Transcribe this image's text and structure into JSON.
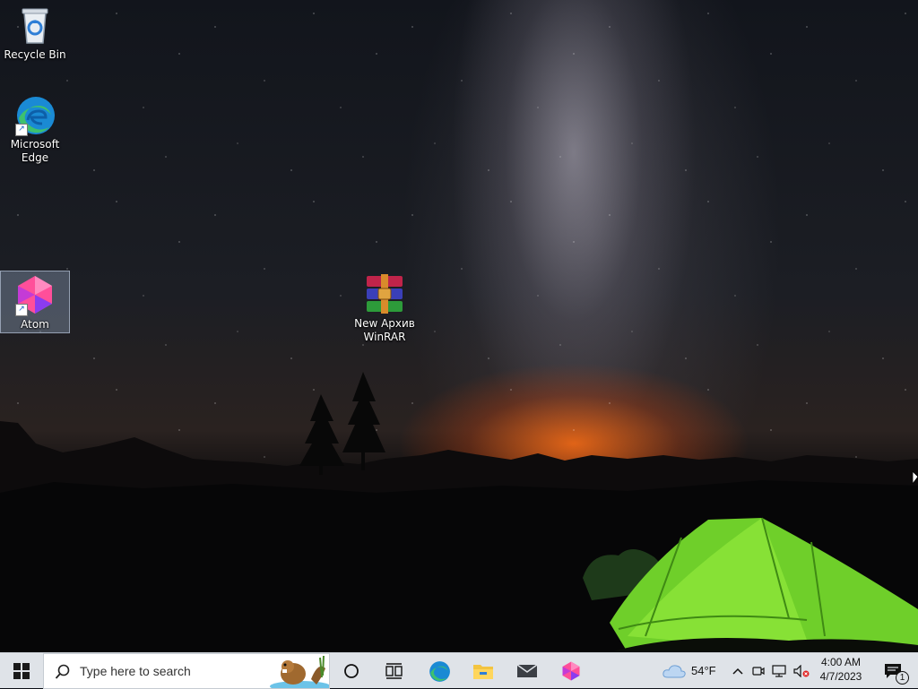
{
  "desktop": {
    "icons": [
      {
        "label": "Recycle Bin",
        "icon": "recycle-bin-icon"
      },
      {
        "label": "Microsoft Edge",
        "label_line1": "Microsoft",
        "label_line2": "Edge",
        "icon": "edge-icon"
      },
      {
        "label": "Atom",
        "icon": "atom-icon",
        "selected": true
      },
      {
        "label": "New Архив WinRAR",
        "label_line1": "New Архив",
        "label_line2": "WinRAR",
        "icon": "winrar-archive-icon"
      }
    ]
  },
  "taskbar": {
    "start_icon": "windows-logo-icon",
    "search": {
      "placeholder": "Type here to search",
      "icon": "search-icon"
    },
    "pinned": [
      {
        "name": "Cortana",
        "icon": "cortana-circle-icon"
      },
      {
        "name": "Task View",
        "icon": "task-view-icon"
      },
      {
        "name": "Microsoft Edge",
        "icon": "edge-icon"
      },
      {
        "name": "File Explorer",
        "icon": "folder-icon"
      },
      {
        "name": "Mail",
        "icon": "mail-icon"
      },
      {
        "name": "Atom",
        "icon": "atom-icon"
      }
    ],
    "tray": {
      "weather": {
        "temp": "54°F",
        "icon": "cloud-icon"
      },
      "icons": [
        "chevron-up-icon",
        "meet-now-icon",
        "network-icon",
        "volume-muted-icon"
      ],
      "clock": {
        "time": "4:00 AM",
        "date": "4/7/2023"
      },
      "notifications": {
        "count": "1",
        "icon": "action-center-icon"
      }
    }
  },
  "colors": {
    "taskbar_bg": "#dfe3e8",
    "selection": "#a0b4d2",
    "edge_blue": "#1a8ad4",
    "edge_green": "#3ec16e",
    "atom_pink": "#ff4f9a"
  }
}
